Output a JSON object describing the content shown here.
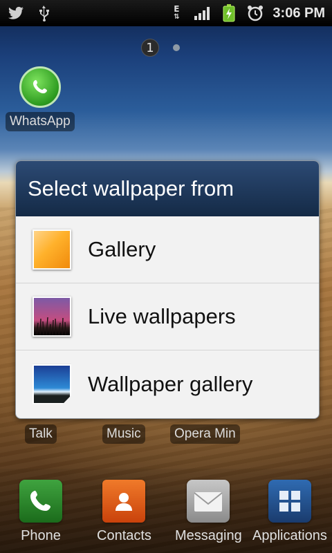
{
  "status_bar": {
    "time": "3:06 PM",
    "icons": [
      "twitter-icon",
      "usb-icon",
      "edge-data-icon",
      "signal-icon",
      "battery-charging-icon",
      "alarm-icon"
    ],
    "network_label": "E"
  },
  "home": {
    "page_number": "1",
    "apps": [
      {
        "name": "WhatsApp",
        "icon": "whatsapp-icon"
      }
    ],
    "row_labels": [
      "Talk",
      "Music",
      "Opera Min"
    ]
  },
  "dialog": {
    "title": "Select wallpaper from",
    "items": [
      {
        "label": "Gallery",
        "icon": "gallery-icon"
      },
      {
        "label": "Live wallpapers",
        "icon": "live-wallpapers-icon"
      },
      {
        "label": "Wallpaper gallery",
        "icon": "wallpaper-gallery-icon"
      }
    ]
  },
  "dock": {
    "items": [
      {
        "label": "Phone",
        "icon": "phone-icon"
      },
      {
        "label": "Contacts",
        "icon": "contacts-icon"
      },
      {
        "label": "Messaging",
        "icon": "messaging-icon"
      },
      {
        "label": "Applications",
        "icon": "applications-icon"
      }
    ]
  },
  "colors": {
    "dialog_title_bg": "#142a46",
    "dialog_body_bg": "#f2f2f2"
  }
}
